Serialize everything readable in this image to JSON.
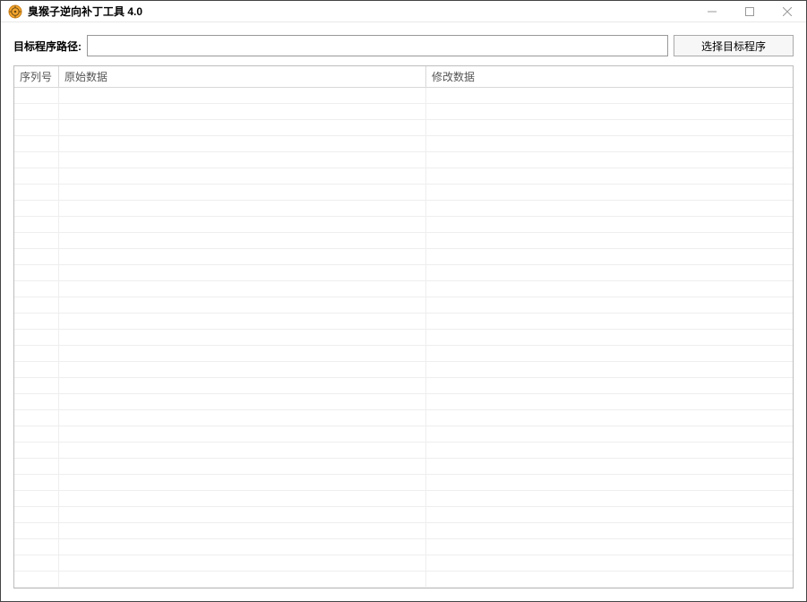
{
  "window": {
    "title": "臭猴子逆向补丁工具 4.0"
  },
  "toolbar": {
    "path_label": "目标程序路径:",
    "path_value": "",
    "select_button": "选择目标程序"
  },
  "table": {
    "columns": {
      "seq": "序列号",
      "original": "原始数据",
      "modified": "修改数据"
    },
    "rows": []
  }
}
